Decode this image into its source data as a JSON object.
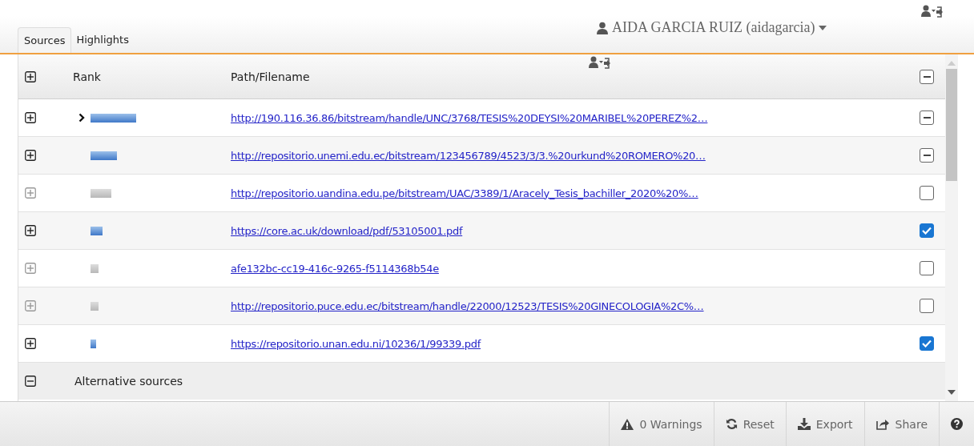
{
  "tabs": [
    {
      "label": "Sources",
      "selected": true
    },
    {
      "label": "Highlights",
      "selected": false
    }
  ],
  "user": {
    "name": "AIDA GARCIA RUIZ (aidagarcia)"
  },
  "table": {
    "columns": [
      "Rank",
      "Path/Filename"
    ],
    "header_checkbox": {
      "partial": true
    },
    "rows": [
      {
        "selected": true,
        "disabled": false,
        "path": "http://190.116.36.86/bitstream/handle/UNC/3768/TESIS%20DEYSI%20MARIBEL%20PEREZ%2…",
        "partial": true
      },
      {
        "selected": false,
        "disabled": false,
        "path": "http://repositorio.unemi.edu.ec/bitstream/123456789/4523/3/3.%20urkund%20ROMERO%20…",
        "partial": true
      },
      {
        "selected": false,
        "disabled": true,
        "path": "http://repositorio.uandina.edu.pe/bitstream/UAC/3389/1/Aracely_Tesis_bachiller_2020%20%…",
        "checked": false
      },
      {
        "selected": false,
        "disabled": false,
        "path": "https://core.ac.uk/download/pdf/53105001.pdf",
        "checked": true
      },
      {
        "selected": false,
        "disabled": true,
        "path": "afe132bc-cc19-416c-9265-f5114368b54e",
        "checked": false
      },
      {
        "selected": false,
        "disabled": true,
        "path": "http://repositorio.puce.edu.ec/bitstream/handle/22000/12523/TESIS%20GINECOLOGIA%2C%…",
        "checked": false
      },
      {
        "selected": false,
        "disabled": false,
        "path": "https://repositorio.unan.edu.ni/10236/1/99339.pdf",
        "checked": true
      }
    ],
    "group": {
      "label": "Alternative sources",
      "expanded": true
    }
  },
  "footer": {
    "warnings": "0 Warnings",
    "buttons": [
      "Reset",
      "Export",
      "Share"
    ]
  }
}
